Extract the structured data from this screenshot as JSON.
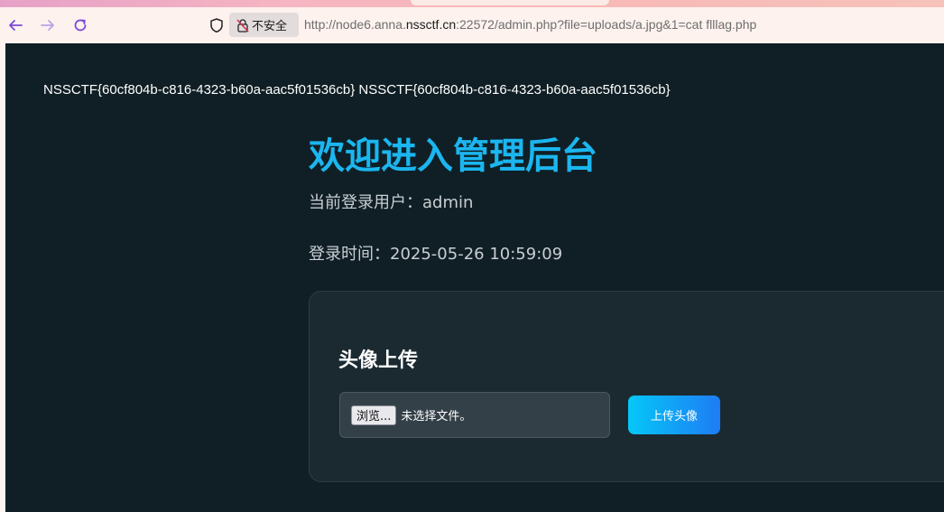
{
  "browser": {
    "security_label": "不安全",
    "url_prefix": "http://node6.anna.",
    "url_host": "nssctf.cn",
    "url_suffix": ":22572/admin.php?file=uploads/a.jpg&1=cat flllag.php",
    "accent_color": "#7b4bd8"
  },
  "page": {
    "flag_output": "NSSCTF{60cf804b-c816-4323-b60a-aac5f01536cb} NSSCTF{60cf804b-c816-4323-b60a-aac5f01536cb}",
    "title": "欢迎进入管理后台",
    "current_user": "当前登录用户：admin",
    "login_time": "登录时间：2025-05-26 10:59:09",
    "title_color": "#1bb6f0",
    "background_color": "#0f1f25"
  },
  "upload": {
    "heading": "头像上传",
    "browse_label": "浏览...",
    "file_status": "未选择文件。",
    "submit_label": "上传头像"
  }
}
